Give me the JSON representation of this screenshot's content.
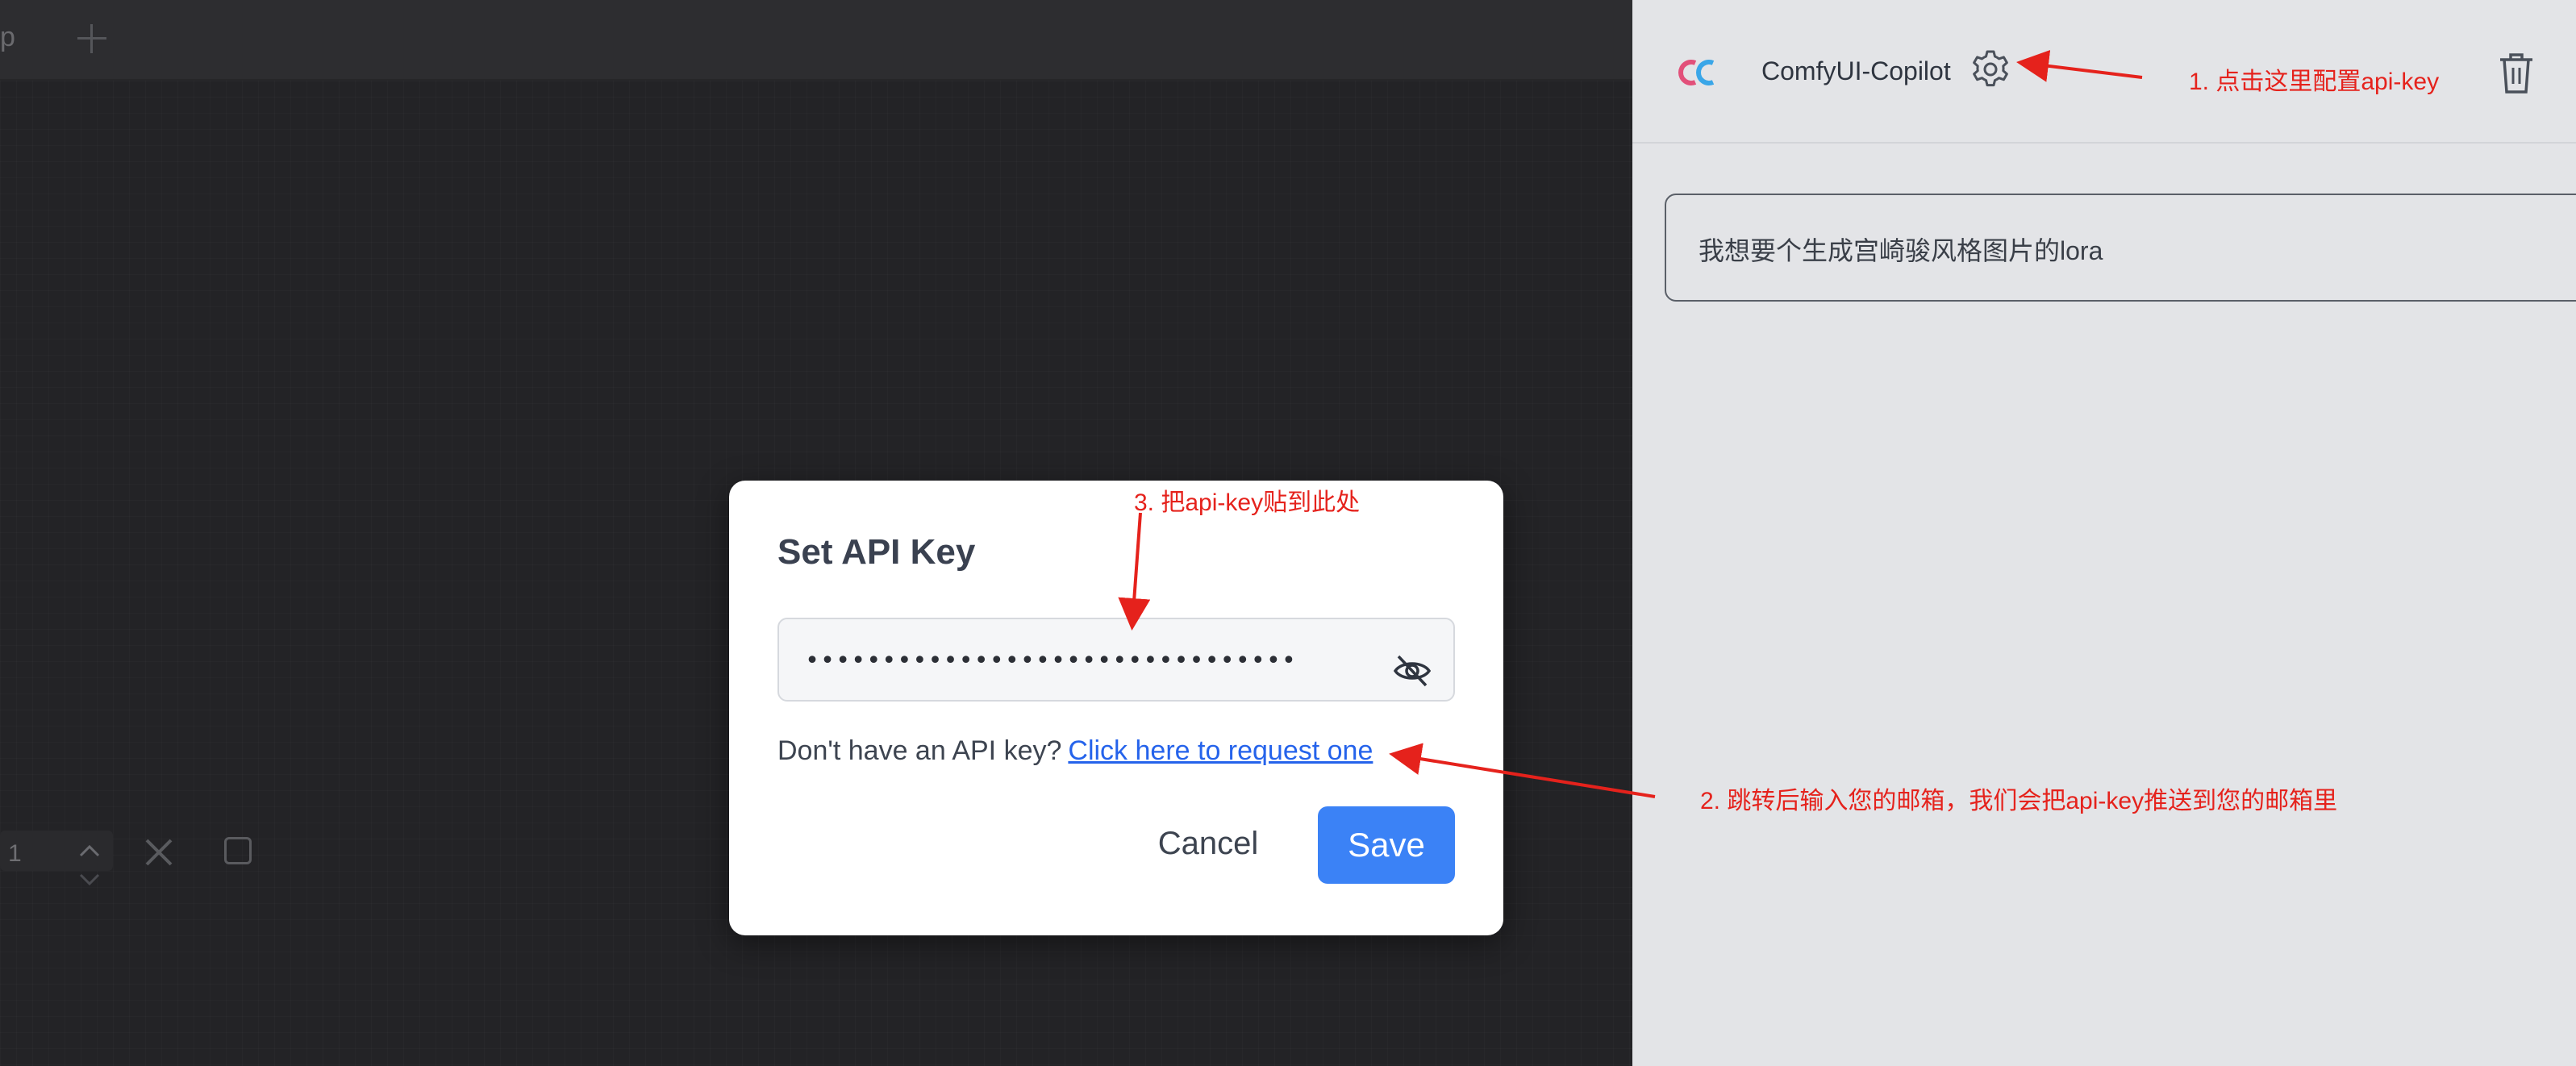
{
  "canvas": {
    "tab_partial": "p",
    "mini_controls": {
      "count_value": "1"
    }
  },
  "modal": {
    "title": "Set API Key",
    "api_key_value": "••••••••••••••••••••••••••••••••",
    "help_text": "Don't have an API key?",
    "link_text": "Click here to request one",
    "cancel_label": "Cancel",
    "save_label": "Save"
  },
  "sidebar": {
    "title": "ComfyUI-Copilot",
    "chat_input_text": "我想要个生成宫崎骏风格图片的lora"
  },
  "annotations": {
    "note_1": "1. 点击这里配置api-key",
    "note_2": "2. 跳转后输入您的邮箱，我们会把api-key推送到您的邮箱里",
    "note_3": "3. 把api-key贴到此处",
    "color": "#e5221c"
  },
  "colors": {
    "accent": "#3b82f6",
    "link": "#2563eb",
    "canvas_bg": "#232326",
    "sidebar_bg": "#e3e4e7"
  }
}
